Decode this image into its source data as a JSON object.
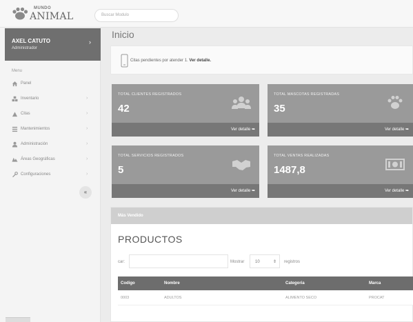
{
  "brand": {
    "small": "MUNDO",
    "big": "ANIMAL"
  },
  "search": {
    "placeholder": "Buscar Modulo"
  },
  "user": {
    "name": "AXEL CATUTO",
    "role": "Administrador"
  },
  "menu": {
    "header": "Menu",
    "items": [
      {
        "label": "Panel",
        "icon": "home-icon",
        "has_arrow": false
      },
      {
        "label": "Inventario",
        "icon": "boxes-icon",
        "has_arrow": true
      },
      {
        "label": "Citas",
        "icon": "calendar-icon",
        "has_arrow": true
      },
      {
        "label": "Mantenimientos",
        "icon": "list-icon",
        "has_arrow": true
      },
      {
        "label": "Administración",
        "icon": "user-icon",
        "has_arrow": true
      },
      {
        "label": "Áreas Geográficas",
        "icon": "map-icon",
        "has_arrow": true
      },
      {
        "label": "Configuraciones",
        "icon": "wrench-icon",
        "has_arrow": true
      }
    ],
    "collapse_glyph": "«"
  },
  "page": {
    "title": "Inicio"
  },
  "notice": {
    "text": "Citas pendientes por atender 1.",
    "link": "Ver detalle."
  },
  "cards": [
    {
      "label": "TOTAL CLIENTES REGISTRADOS",
      "value": "42",
      "link": "Ver detalle",
      "icon": "users-icon"
    },
    {
      "label": "TOTAL MASCOTAS REGISTRADAS",
      "value": "35",
      "link": "Ver detalle",
      "icon": "paw-icon"
    },
    {
      "label": "TOTAL SERVICIOS REGISTRADOS",
      "value": "5",
      "link": "Ver detalle",
      "icon": "handshake-icon"
    },
    {
      "label": "TOTAL VENTAS REALIZADAS",
      "value": "1487,8",
      "link": "Ver detalle",
      "icon": "money-icon"
    }
  ],
  "products_panel": {
    "header": "Más Vendido",
    "title": "PRODUCTOS",
    "search_label": "car:",
    "show_label": "Mostrar",
    "show_value": "10",
    "records_label": "registros",
    "columns": [
      "Codigo",
      "Nombre",
      "Categoria",
      "Marca"
    ],
    "rows": [
      [
        "0003",
        "ADULTOS",
        "ALIMENTO SECO",
        "PROCAT"
      ]
    ]
  },
  "colors": {
    "card_body": "#9a9a9a",
    "card_footer": "#777777",
    "user_panel": "#6f6f6f",
    "table_header": "#6d6d6d"
  }
}
